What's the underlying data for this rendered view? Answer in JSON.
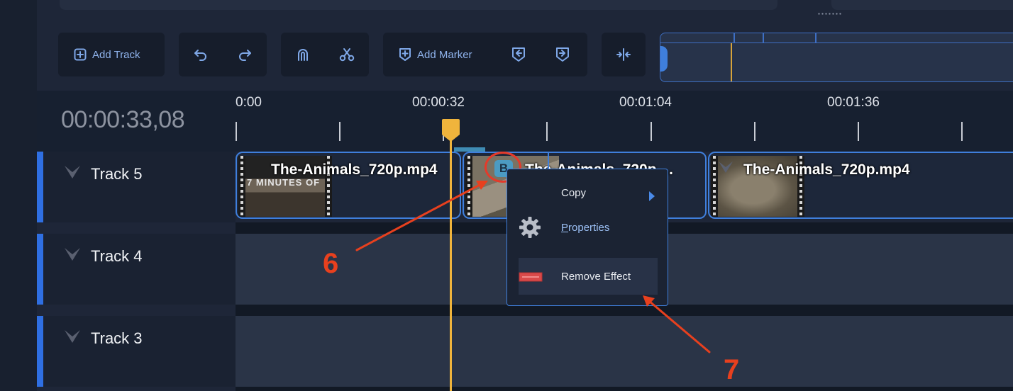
{
  "toolbar": {
    "add_track_label": "Add Track",
    "add_marker_label": "Add Marker"
  },
  "timeline": {
    "current_time": "00:00:33,08",
    "ruler_labels": [
      "0:00",
      "00:00:32",
      "00:01:04",
      "00:01:36"
    ]
  },
  "tracks": [
    {
      "name": "Track 5"
    },
    {
      "name": "Track 4"
    },
    {
      "name": "Track 3"
    }
  ],
  "clips": [
    {
      "title": "The-Animals_720p.mp4",
      "thumb_text": "7 MINUTES OF"
    },
    {
      "title": "The-Animals_720p...."
    },
    {
      "title": "The-Animals_720p.mp4"
    }
  ],
  "effect_badge": "B",
  "context_menu": {
    "items": [
      {
        "label": "Copy"
      },
      {
        "label": "Properties"
      },
      {
        "label": "Remove Effect"
      }
    ]
  },
  "annotations": {
    "step_6": "6",
    "step_7": "7"
  },
  "colors": {
    "accent": "#3f7fdc",
    "playhead": "#f0b43c",
    "annotation": "#e8401e"
  }
}
